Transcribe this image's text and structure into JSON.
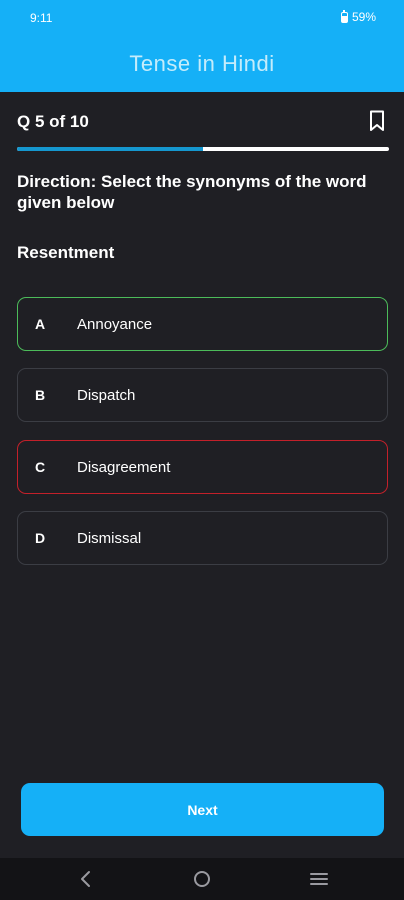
{
  "status_bar": {
    "time": "9:11",
    "battery_percent": "59%",
    "battery_icon": "battery-icon"
  },
  "app_bar": {
    "title": "Tense in Hindi",
    "color": "#15b0f7"
  },
  "question": {
    "counter": "Q 5 of 10",
    "progress_fraction": 0.5,
    "direction": "Direction: Select the synonyms of the word given below",
    "word": "Resentment",
    "bookmark_icon": "bookmark-icon"
  },
  "options": [
    {
      "letter": "A",
      "text": "Annoyance",
      "state": "correct"
    },
    {
      "letter": "B",
      "text": "Dispatch",
      "state": "neutral"
    },
    {
      "letter": "C",
      "text": "Disagreement",
      "state": "wrong"
    },
    {
      "letter": "D",
      "text": "Dismissal",
      "state": "neutral"
    }
  ],
  "next_button": {
    "label": "Next"
  },
  "colors": {
    "accent": "#15b0f7",
    "background": "#1f1f24",
    "correct": "#4cbb5a",
    "wrong": "#c3202a",
    "progress_fill": "#1597cf"
  },
  "nav_bar": {
    "icons": [
      "back-icon",
      "home-icon",
      "menu-icon"
    ]
  }
}
